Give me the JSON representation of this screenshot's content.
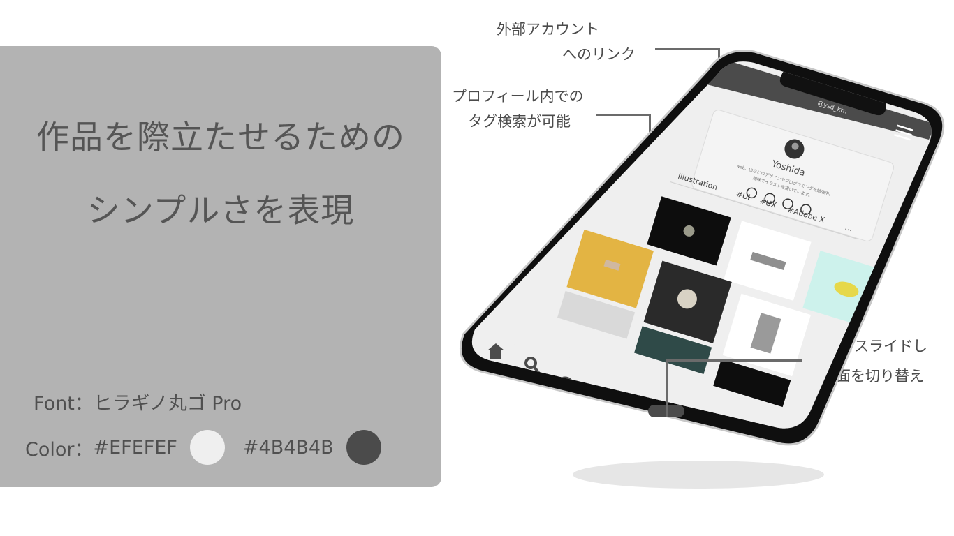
{
  "info": {
    "headline_line1": "作品を際立たせるための",
    "headline_line2": "シンプルさを表現",
    "font_line": "Font：ヒラギノ丸ゴ Pro",
    "color_label": "Color：",
    "color1_hex": "#EFEFEF",
    "color2_hex": "#4B4B4B"
  },
  "callouts": {
    "external_line1": "外部アカウント",
    "external_line2": "へのリンク",
    "tag_line1": "プロフィール内での",
    "tag_line2": "タグ検索が可能",
    "slide_line1": "バーをスライドし",
    "slide_line2": "画面を切り替え"
  },
  "app": {
    "handle": "@ysd_ktn",
    "name": "Yoshida",
    "bio_line1": "web、UIなどのデザインやプログラミングを勉強中。",
    "bio_line2": "趣味でイラストを描いています。",
    "tags": [
      "illustration",
      "#UI",
      "#UX",
      "#Adobe X",
      "…"
    ],
    "social_icons": [
      "github-icon",
      "instagram-icon",
      "twitter-icon",
      "facebook-icon"
    ],
    "nav_icons": [
      "home-icon",
      "search-icon",
      "add-icon",
      "bell-icon",
      "profile-icon"
    ],
    "menu_icon": "hamburger-menu-icon"
  },
  "colors": {
    "light": "#EFEFEF",
    "dark": "#4B4B4B",
    "card_bg": "#B3B3B3"
  }
}
